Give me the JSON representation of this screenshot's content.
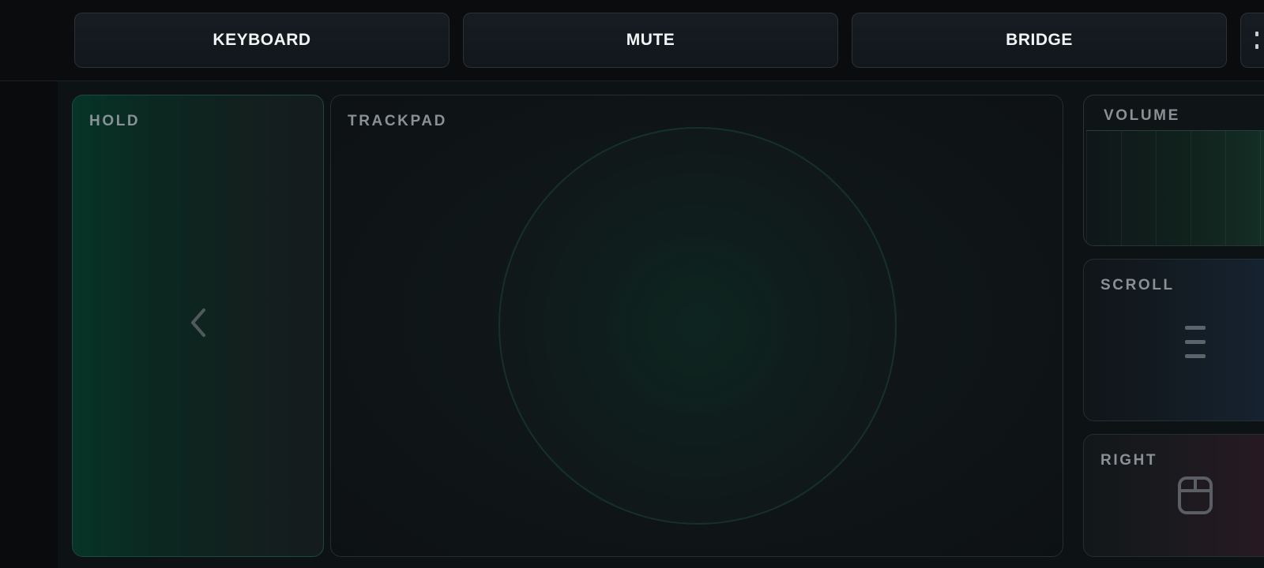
{
  "toolbar": {
    "buttons": [
      {
        "label": "KEYBOARD"
      },
      {
        "label": "MUTE"
      },
      {
        "label": "BRIDGE"
      }
    ]
  },
  "panels": {
    "hold": {
      "label": "HOLD",
      "icon": "chevron-left-icon"
    },
    "trackpad": {
      "label": "TRACKPAD"
    },
    "volume": {
      "label": "VOLUME"
    },
    "scroll": {
      "label": "SCROLL",
      "icon": "scroll-lines-icon"
    },
    "right": {
      "label": "RIGHT",
      "icon": "mouse-icon"
    }
  },
  "colors": {
    "accent_green": "#063427",
    "scroll_blue": "#182434",
    "right_red": "#2a1923"
  }
}
